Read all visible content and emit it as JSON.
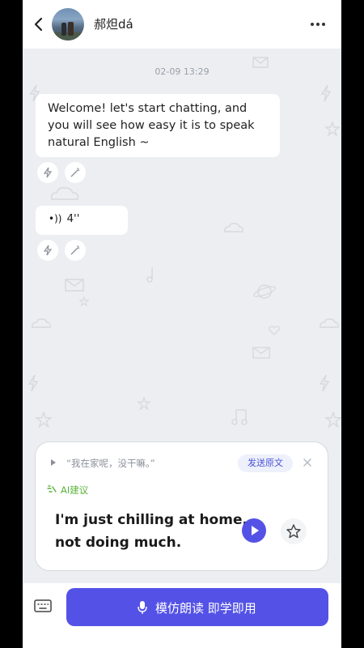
{
  "header": {
    "contact_name": "郝炟dá"
  },
  "chat": {
    "timestamp": "02-09 13:29",
    "messages": [
      {
        "text": "Welcome! let's start chatting, and you will see how easy it is to speak natural English ~"
      },
      {
        "audio_duration": "4''"
      }
    ]
  },
  "suggestion_card": {
    "original_text": "“我在家呢，没干嘛。”",
    "send_original_label": "发送原文",
    "ai_label": "AI建议",
    "suggested_text": "I'm just chilling at home, not doing much."
  },
  "bottom": {
    "main_button_label": "模仿朗读  即学即用"
  },
  "colors": {
    "accent": "#5452e6",
    "ai_green": "#59b33a",
    "background": "#eceef2"
  }
}
